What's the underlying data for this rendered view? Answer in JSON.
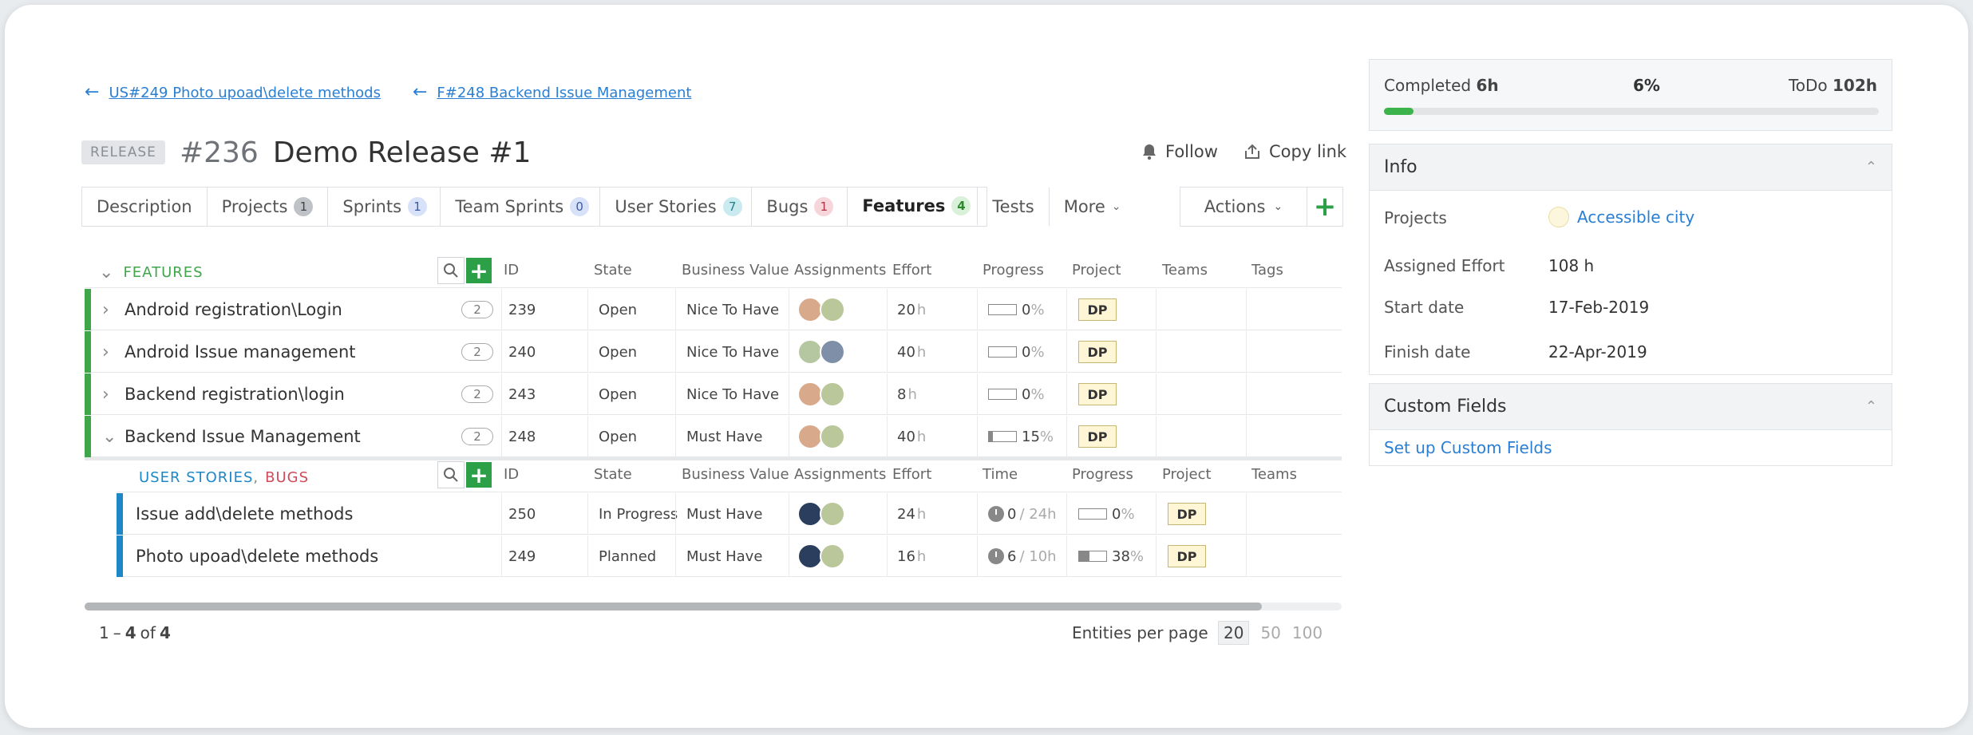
{
  "breadcrumbs": [
    {
      "label": "US#249 Photo upoad\\delete methods"
    },
    {
      "label": "F#248 Backend Issue Management"
    }
  ],
  "entity": {
    "type": "RELEASE",
    "id": "#236",
    "name": "Demo Release #1"
  },
  "header_actions": {
    "follow": "Follow",
    "copy_link": "Copy link"
  },
  "tabs": [
    {
      "label": "Description",
      "count": null
    },
    {
      "label": "Projects",
      "count": "1"
    },
    {
      "label": "Sprints",
      "count": "1"
    },
    {
      "label": "Team Sprints",
      "count": "0"
    },
    {
      "label": "User Stories",
      "count": "7"
    },
    {
      "label": "Bugs",
      "count": "1"
    },
    {
      "label": "Features",
      "count": "4"
    },
    {
      "label": "Tests",
      "count": null
    },
    {
      "label": "More",
      "count": null
    }
  ],
  "actions_label": "Actions",
  "features_table": {
    "section_title": "FEATURES",
    "columns": [
      "ID",
      "State",
      "Business Value",
      "Assignments",
      "Effort",
      "Progress",
      "Project",
      "Teams",
      "Tags"
    ],
    "rows": [
      {
        "name": "Android registration\\Login",
        "children": "2",
        "id": "239",
        "state": "Open",
        "business_value": "Nice To Have",
        "effort": "20",
        "effort_unit": "h",
        "progress": "0",
        "project": "DP"
      },
      {
        "name": "Android Issue management",
        "children": "2",
        "id": "240",
        "state": "Open",
        "business_value": "Nice To Have",
        "effort": "40",
        "effort_unit": "h",
        "progress": "0",
        "project": "DP"
      },
      {
        "name": "Backend registration\\login",
        "children": "2",
        "id": "243",
        "state": "Open",
        "business_value": "Nice To Have",
        "effort": "8",
        "effort_unit": "h",
        "progress": "0",
        "project": "DP"
      },
      {
        "name": "Backend Issue Management",
        "children": "2",
        "id": "248",
        "state": "Open",
        "business_value": "Must Have",
        "effort": "40",
        "effort_unit": "h",
        "progress": "15",
        "project": "DP"
      }
    ]
  },
  "sub_table": {
    "title_user_stories": "USER STORIES",
    "title_sep": ",",
    "title_bugs": "BUGS",
    "columns": [
      "ID",
      "State",
      "Business Value",
      "Assignments",
      "Effort",
      "Time",
      "Progress",
      "Project",
      "Teams"
    ],
    "rows": [
      {
        "name": "Issue add\\delete methods",
        "id": "250",
        "state": "In Progress",
        "business_value": "Must Have",
        "effort": "24",
        "effort_unit": "h",
        "time_spent": "0",
        "time_total": "/ 24h",
        "progress": "0",
        "project": "DP"
      },
      {
        "name": "Photo upoad\\delete methods",
        "id": "249",
        "state": "Planned",
        "business_value": "Must Have",
        "effort": "16",
        "effort_unit": "h",
        "time_spent": "6",
        "time_total": "/ 10h",
        "progress": "38",
        "project": "DP"
      }
    ]
  },
  "pagination": {
    "range_start": "1",
    "range_dash": "–",
    "range_end": "4",
    "of_word": "of",
    "total": "4",
    "per_page_label": "Entities per page",
    "options": [
      "20",
      "50",
      "100"
    ]
  },
  "summary": {
    "completed_label": "Completed",
    "completed_value": "6h",
    "percent": "6%",
    "percent_value": 6,
    "todo_label": "ToDo",
    "todo_value": "102h"
  },
  "info": {
    "title": "Info",
    "projects_label": "Projects",
    "projects_value": "Accessible city",
    "effort_label": "Assigned Effort",
    "effort_value": "108 h",
    "start_label": "Start date",
    "start_value": "17-Feb-2019",
    "finish_label": "Finish date",
    "finish_value": "22-Apr-2019"
  },
  "custom_fields": {
    "title": "Custom Fields",
    "link": "Set up Custom Fields"
  },
  "colors": {
    "accent": "#2a7fd4",
    "green": "#2ba046",
    "feature_stripe": "#3fa64a",
    "story_stripe": "#1e87c8",
    "bug_title": "#d04a5a"
  }
}
